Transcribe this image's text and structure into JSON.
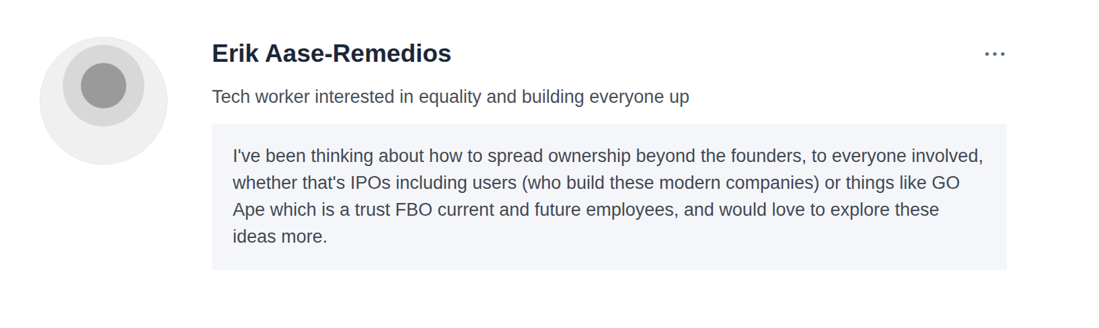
{
  "profile": {
    "name": "Erik Aase-Remedios",
    "bio": "Tech worker interested in equality and building everyone up"
  },
  "message": "I've been thinking about how to spread ownership beyond the founders, to everyone involved, whether that's IPOs including users (who build these modern companies) or things like GO Ape which is a trust FBO current and future employees, and would love to explore these ideas more.",
  "menu": {
    "icon": "•••"
  }
}
